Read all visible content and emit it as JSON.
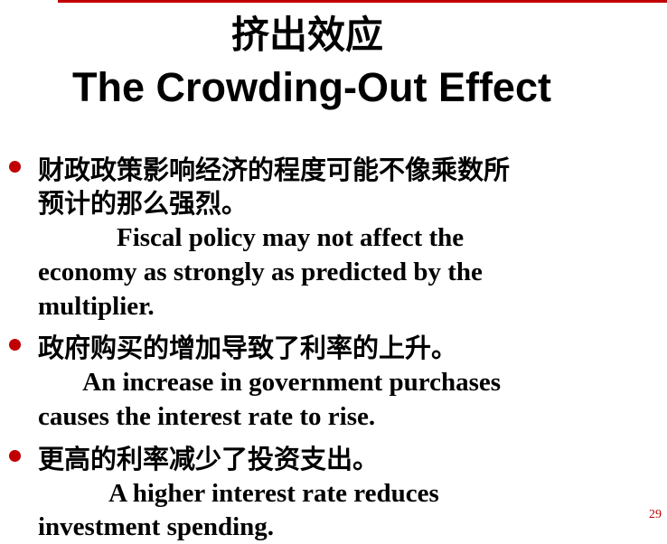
{
  "title": {
    "chinese": "挤出效应",
    "english": "The Crowding-Out Effect"
  },
  "bullets": [
    {
      "chinese": [
        "财政政策影响经济的程度可能不像乘数所",
        "预计的那么强烈。"
      ],
      "english": [
        "            Fiscal policy may not affect the",
        "economy as strongly as predicted by the",
        "multiplier."
      ]
    },
    {
      "chinese": [
        "政府购买的增加导致了利率的上升。"
      ],
      "english": [
        "       An increase in government purchases",
        "causes the interest rate to rise."
      ]
    },
    {
      "chinese": [
        "更高的利率减少了投资支出。"
      ],
      "english": [
        "           A higher interest rate reduces",
        "investment spending."
      ]
    }
  ],
  "page_number": "29",
  "colors": {
    "accent": "#c00000",
    "text": "#000000"
  }
}
